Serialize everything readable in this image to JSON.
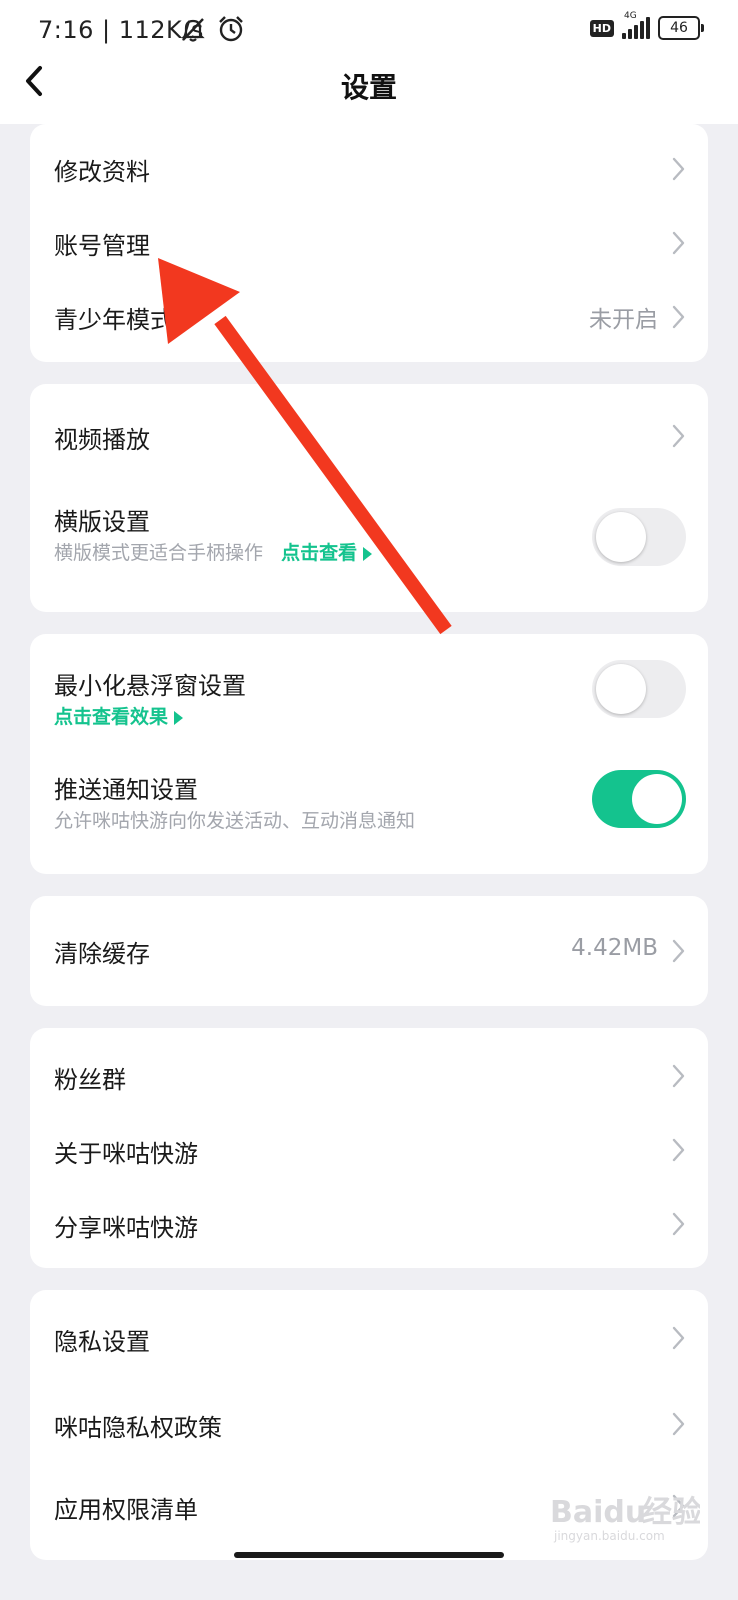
{
  "status_bar": {
    "time_speed": "7:16 | 112K/s",
    "icons": [
      "bell-muted-icon",
      "alarm-clock-icon"
    ],
    "hd_label": "HD",
    "network_label": "4G",
    "battery_level": "46"
  },
  "header": {
    "title": "设置",
    "back_icon": "chevron-left-icon"
  },
  "groups": {
    "account": {
      "edit_profile": "修改资料",
      "account_management": "账号管理",
      "teen_mode": "青少年模式",
      "teen_mode_value": "未开启"
    },
    "display": {
      "video_playback": "视频播放",
      "landscape_title": "横版设置",
      "landscape_desc": "横版模式更适合手柄操作",
      "landscape_link": "点击查看",
      "landscape_enabled": false
    },
    "notifications": {
      "floating_window_title": "最小化悬浮窗设置",
      "floating_window_link": "点击查看效果",
      "floating_window_enabled": false,
      "push_title": "推送通知设置",
      "push_desc": "允许咪咕快游向你发送活动、互动消息通知",
      "push_enabled": true
    },
    "storage": {
      "clear_cache": "清除缓存",
      "cache_size": "4.42MB"
    },
    "about": {
      "fans_group": "粉丝群",
      "about_app": "关于咪咕快游",
      "share_app": "分享咪咕快游"
    },
    "privacy": {
      "privacy_settings": "隐私设置",
      "privacy_policy": "咪咕隐私权政策",
      "permissions_list": "应用权限清单"
    }
  },
  "colors": {
    "accent": "#14c38e",
    "annotation_arrow": "#f2381f",
    "page_background": "#efeff3"
  },
  "watermark": {
    "brand": "Baidu",
    "chinese": "经验",
    "url": "jingyan.baidu.com"
  }
}
